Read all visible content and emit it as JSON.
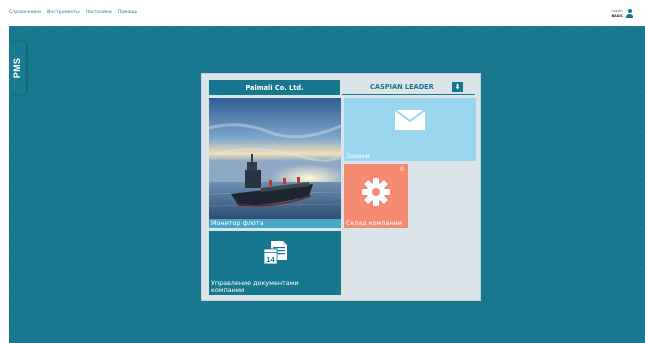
{
  "menu": {
    "items": [
      "Справочники",
      "Инструменты",
      "Настройки",
      "Помощь"
    ]
  },
  "user": {
    "name": "Leader",
    "role": "BASIC"
  },
  "sidebar": {
    "tab_label": "PMS"
  },
  "dashboard": {
    "company_tab": "Palmali Co. Ltd.",
    "vessel_tab": "CASPIAN LEADER",
    "tiles": {
      "fleet": {
        "label": "Монитор флота"
      },
      "requests": {
        "label": "Заявки"
      },
      "warehouse": {
        "label": "Склад компании",
        "badge": "0"
      },
      "documents": {
        "label": "Управление документами компании"
      }
    }
  },
  "colors": {
    "teal": "#17778e",
    "light_blue": "#99d5ec",
    "salmon": "#f48a72",
    "panel_bg": "#dbe4e8"
  },
  "icons": {
    "requests": "envelope-icon",
    "warehouse": "gear-icon",
    "documents": "calendar-document-icon",
    "download": "download-icon",
    "user": "user-icon"
  }
}
